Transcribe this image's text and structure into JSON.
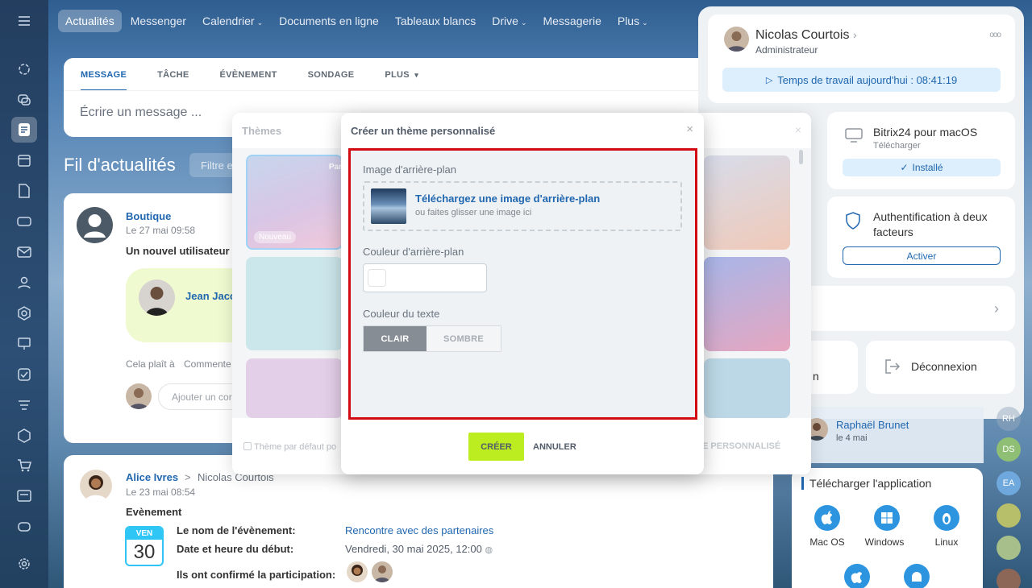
{
  "topnav": {
    "tabs": [
      {
        "label": "Actualités",
        "active": true,
        "caret": false
      },
      {
        "label": "Messenger",
        "caret": false
      },
      {
        "label": "Calendrier",
        "caret": true
      },
      {
        "label": "Documents en ligne",
        "caret": false
      },
      {
        "label": "Tableaux blancs",
        "caret": false
      },
      {
        "label": "Drive",
        "caret": true
      },
      {
        "label": "Messagerie",
        "caret": false
      },
      {
        "label": "Plus",
        "caret": true
      }
    ]
  },
  "composer": {
    "tabs": [
      "MESSAGE",
      "TÂCHE",
      "ÉVÈNEMENT",
      "SONDAGE",
      "PLUS"
    ],
    "placeholder": "Écrire un message ..."
  },
  "feed": {
    "title": "Fil d'actualités",
    "filter_placeholder": "Filtre et"
  },
  "post1": {
    "author": "Boutique",
    "date": "Le 27 mai 09:58",
    "text": "Un nouvel utilisateur v",
    "user_name": "Jean Jaco",
    "like": "Cela plaît à",
    "comment": "Commente",
    "comment_placeholder": "Ajouter un cor"
  },
  "post2": {
    "author": "Alice Ivres",
    "arrow": ">",
    "recipient": "Nicolas Courtois",
    "date": "Le 23 mai 08:54",
    "type": "Evènement",
    "cal_day": "VEN",
    "cal_num": "30",
    "rows": [
      {
        "k": "Le nom de l'évènement:",
        "v": "Rencontre avec des partenaires"
      },
      {
        "k": "Date et heure du début:",
        "v": "Vendredi, 30 mai 2025, 12:00"
      },
      {
        "k": "Ils ont confirmé la participation:",
        "v": ""
      }
    ]
  },
  "themes": {
    "title": "Thèmes",
    "new_badge": "Nouveau",
    "tile_label": "Par",
    "default_checkbox": "Thème par défaut po",
    "custom_button": "E PERSONNALISÉ"
  },
  "custom_theme": {
    "title": "Créer un thème personnalisé",
    "bg_image_label": "Image d'arrière-plan",
    "upload_link": "Téléchargez une image d'arrière-plan",
    "upload_hint": "ou faites glisser une image ici",
    "bg_color_label": "Couleur d'arrière-plan",
    "text_color_label": "Couleur du texte",
    "light": "CLAIR",
    "dark": "SOMBRE",
    "create": "CRÉER",
    "cancel": "ANNULER"
  },
  "profile": {
    "name": "Nicolas Courtois",
    "role": "Administrateur",
    "work_time": "Temps de travail aujourd'hui : 08:41:19",
    "more": "ooo"
  },
  "mac": {
    "title": "Bitrix24 pour macOS",
    "subtitle": "Télécharger",
    "status": "Installé"
  },
  "twofa": {
    "title": "Authentification à deux facteurs",
    "button": "Activer"
  },
  "logout": {
    "partial": "n",
    "label": "Déconnexion"
  },
  "activity": {
    "name": "Raphaël Brunet",
    "date": "le 4 mai"
  },
  "download": {
    "title": "Télécharger l'application",
    "apps": [
      {
        "name": "Mac OS"
      },
      {
        "name": "Windows"
      },
      {
        "name": "Linux"
      }
    ]
  },
  "side_avatars": [
    "RH",
    "DS",
    "EA"
  ],
  "colors": {
    "accent": "#2067b0",
    "create_btn": "#bbed21",
    "highlight": "#d20a11"
  }
}
